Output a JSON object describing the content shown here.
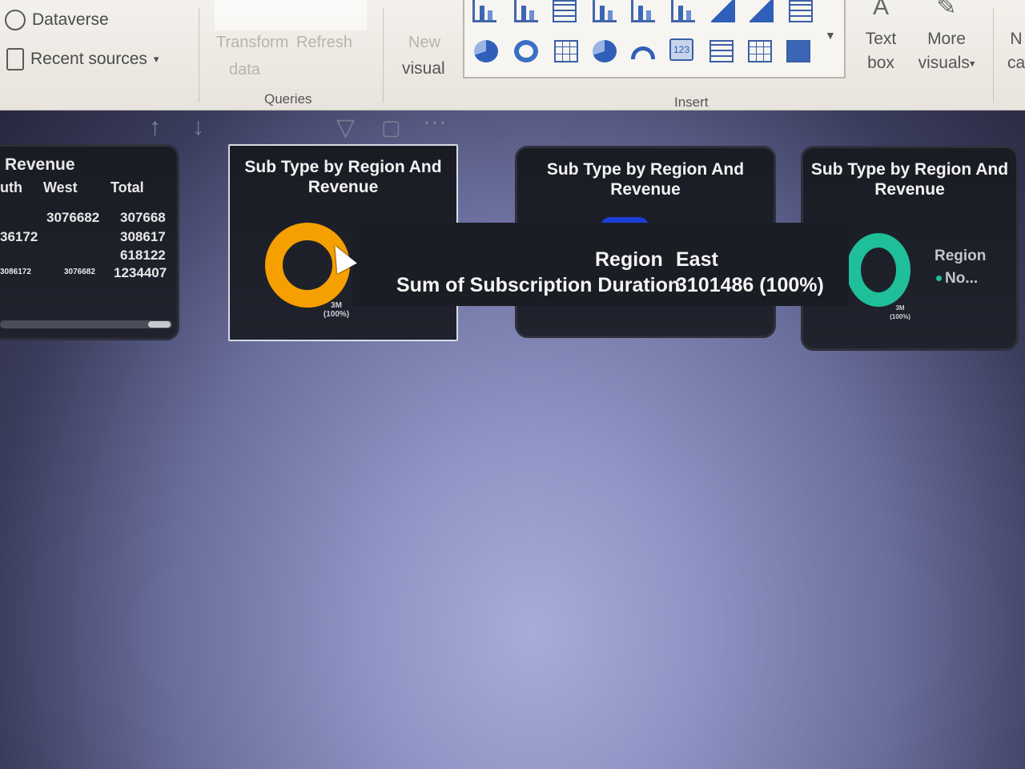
{
  "ribbon": {
    "data_items": [
      {
        "label": "Dataverse",
        "icon": "dataverse-icon"
      },
      {
        "label": "Recent sources",
        "icon": "recent-sources-icon"
      }
    ],
    "transform_label": "Transform",
    "refresh_label": "Refresh",
    "data_label": "data",
    "queries_label": "Queries",
    "new_visual_top": "New",
    "new_visual_label": "visual",
    "insert_label": "Insert",
    "text_box_line1": "Text",
    "text_box_line2": "box",
    "more_visuals_line1": "More",
    "more_visuals_line2": "visuals",
    "cut_label_1": "N",
    "cut_label_2": "ca",
    "kpi_icon_text": "123"
  },
  "visual_header": {
    "icons": [
      "sort-up-icon",
      "sort-down-icon",
      "filter-icon",
      "focus-mode-icon",
      "more-options-icon"
    ]
  },
  "matrix_card": {
    "title": "Revenue",
    "col_south": "uth",
    "col_west": "West",
    "col_total": "Total",
    "rows": [
      {
        "south": "",
        "west": "3076682",
        "total": "307668"
      },
      {
        "south": "36172",
        "west": "",
        "total": "308617"
      },
      {
        "south": "",
        "west": "",
        "total": "618122"
      },
      {
        "south": "3086172",
        "west": "3076682",
        "total": "1234407"
      }
    ]
  },
  "cards": [
    {
      "title_line1": "Sub Type by Region And",
      "title_line2": "Revenue",
      "donut_value": "3M",
      "donut_pct": "(100%)",
      "color": "#f5a000"
    },
    {
      "title_line1": "Sub Type by Region And",
      "title_line2": "Revenue",
      "color": "#1a3fd6"
    },
    {
      "title_line1": "Sub Type by Region And",
      "title_line2": "Revenue",
      "donut_value": "3M",
      "donut_pct": "(100%)",
      "color": "#1fbf9a",
      "legend_title": "Region",
      "legend_item": "No..."
    }
  ],
  "tooltip": {
    "field1_label": "Region",
    "field1_value": "East",
    "field2_label": "Sum of Subscription Duration",
    "field2_value": "3101486 (100%)"
  }
}
